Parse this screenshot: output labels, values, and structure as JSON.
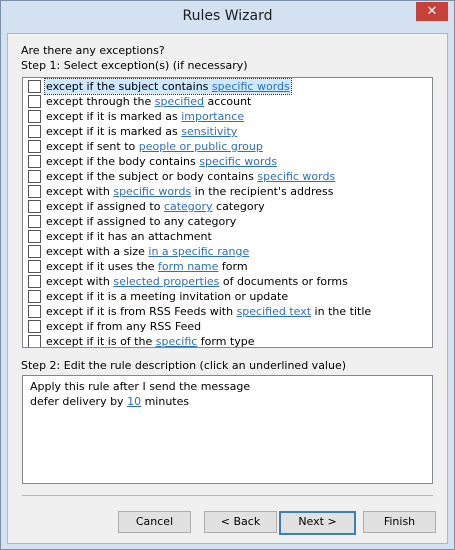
{
  "window": {
    "title": "Rules Wizard",
    "close_glyph": "✕"
  },
  "header": {
    "question": "Are there any exceptions?",
    "step1": "Step 1: Select exception(s) (if necessary)"
  },
  "exceptions": [
    {
      "parts": [
        {
          "t": "except if the subject contains "
        },
        {
          "t": "specific words",
          "link": true
        }
      ]
    },
    {
      "parts": [
        {
          "t": "except through the "
        },
        {
          "t": "specified",
          "link": true
        },
        {
          "t": " account"
        }
      ]
    },
    {
      "parts": [
        {
          "t": "except if it is marked as "
        },
        {
          "t": "importance",
          "link": true
        }
      ]
    },
    {
      "parts": [
        {
          "t": "except if it is marked as "
        },
        {
          "t": "sensitivity",
          "link": true
        }
      ]
    },
    {
      "parts": [
        {
          "t": "except if sent to "
        },
        {
          "t": "people or public group",
          "link": true
        }
      ]
    },
    {
      "parts": [
        {
          "t": "except if the body contains "
        },
        {
          "t": "specific words",
          "link": true
        }
      ]
    },
    {
      "parts": [
        {
          "t": "except if the subject or body contains "
        },
        {
          "t": "specific words",
          "link": true
        }
      ]
    },
    {
      "parts": [
        {
          "t": "except with "
        },
        {
          "t": "specific words",
          "link": true
        },
        {
          "t": " in the recipient's address"
        }
      ]
    },
    {
      "parts": [
        {
          "t": "except if assigned to "
        },
        {
          "t": "category",
          "link": true
        },
        {
          "t": " category"
        }
      ]
    },
    {
      "parts": [
        {
          "t": "except if assigned to any category"
        }
      ]
    },
    {
      "parts": [
        {
          "t": "except if it has an attachment"
        }
      ]
    },
    {
      "parts": [
        {
          "t": "except with a size "
        },
        {
          "t": "in a specific range",
          "link": true
        }
      ]
    },
    {
      "parts": [
        {
          "t": "except if it uses the "
        },
        {
          "t": "form name",
          "link": true
        },
        {
          "t": " form"
        }
      ]
    },
    {
      "parts": [
        {
          "t": "except with "
        },
        {
          "t": "selected properties",
          "link": true
        },
        {
          "t": " of documents or forms"
        }
      ]
    },
    {
      "parts": [
        {
          "t": "except if it is a meeting invitation or update"
        }
      ]
    },
    {
      "parts": [
        {
          "t": "except if it is from RSS Feeds with "
        },
        {
          "t": "specified text",
          "link": true
        },
        {
          "t": " in the title"
        }
      ]
    },
    {
      "parts": [
        {
          "t": "except if from any RSS Feed"
        }
      ]
    },
    {
      "parts": [
        {
          "t": "except if it is of the "
        },
        {
          "t": "specific",
          "link": true
        },
        {
          "t": " form type"
        }
      ]
    }
  ],
  "step2": {
    "label": "Step 2: Edit the rule description (click an underlined value)",
    "line1": "Apply this rule after I send the message",
    "line2_prefix": "defer delivery by ",
    "line2_link": "10",
    "line2_suffix": " minutes"
  },
  "buttons": {
    "cancel": "Cancel",
    "back": "< Back",
    "next": "Next >",
    "finish": "Finish"
  }
}
